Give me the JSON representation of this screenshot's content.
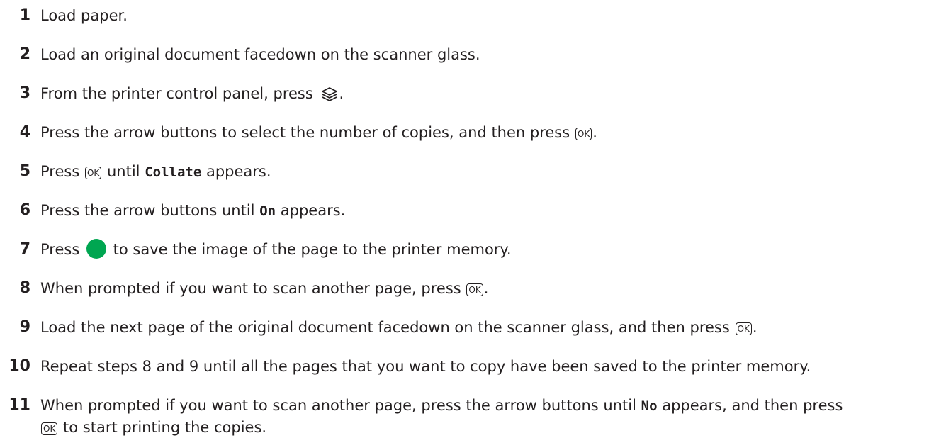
{
  "ok_key_label": "OK",
  "start_color": "#00a651",
  "icons": {
    "copy": "copy-layers-icon",
    "start": "start-button-green-circle-icon",
    "ok": "ok-key-icon"
  },
  "steps": [
    {
      "num": "1",
      "text": "Load paper."
    },
    {
      "num": "2",
      "text": "Load an original document facedown on the scanner glass."
    },
    {
      "num": "3",
      "before": "From the printer control panel, press",
      "after": "."
    },
    {
      "num": "4",
      "before": "Press the arrow buttons to select the number of copies, and then press",
      "after": "."
    },
    {
      "num": "5",
      "before": "Press",
      "mid": "until",
      "code": "Collate",
      "after": "appears."
    },
    {
      "num": "6",
      "before": "Press the arrow buttons until",
      "code": "On",
      "after": "appears."
    },
    {
      "num": "7",
      "before": "Press",
      "after": "to save the image of the page to the printer memory."
    },
    {
      "num": "8",
      "before": "When prompted if you want to scan another page, press",
      "after": "."
    },
    {
      "num": "9",
      "before": "Load the next page of the original document facedown on the scanner glass, and then press",
      "after": "."
    },
    {
      "num": "10",
      "text": "Repeat steps 8 and 9 until all the pages that you want to copy have been saved to the printer memory."
    },
    {
      "num": "11",
      "before": "When prompted if you want to scan another page, press the arrow buttons until",
      "code": "No",
      "mid": "appears, and then press",
      "after": "to start printing the copies."
    }
  ]
}
